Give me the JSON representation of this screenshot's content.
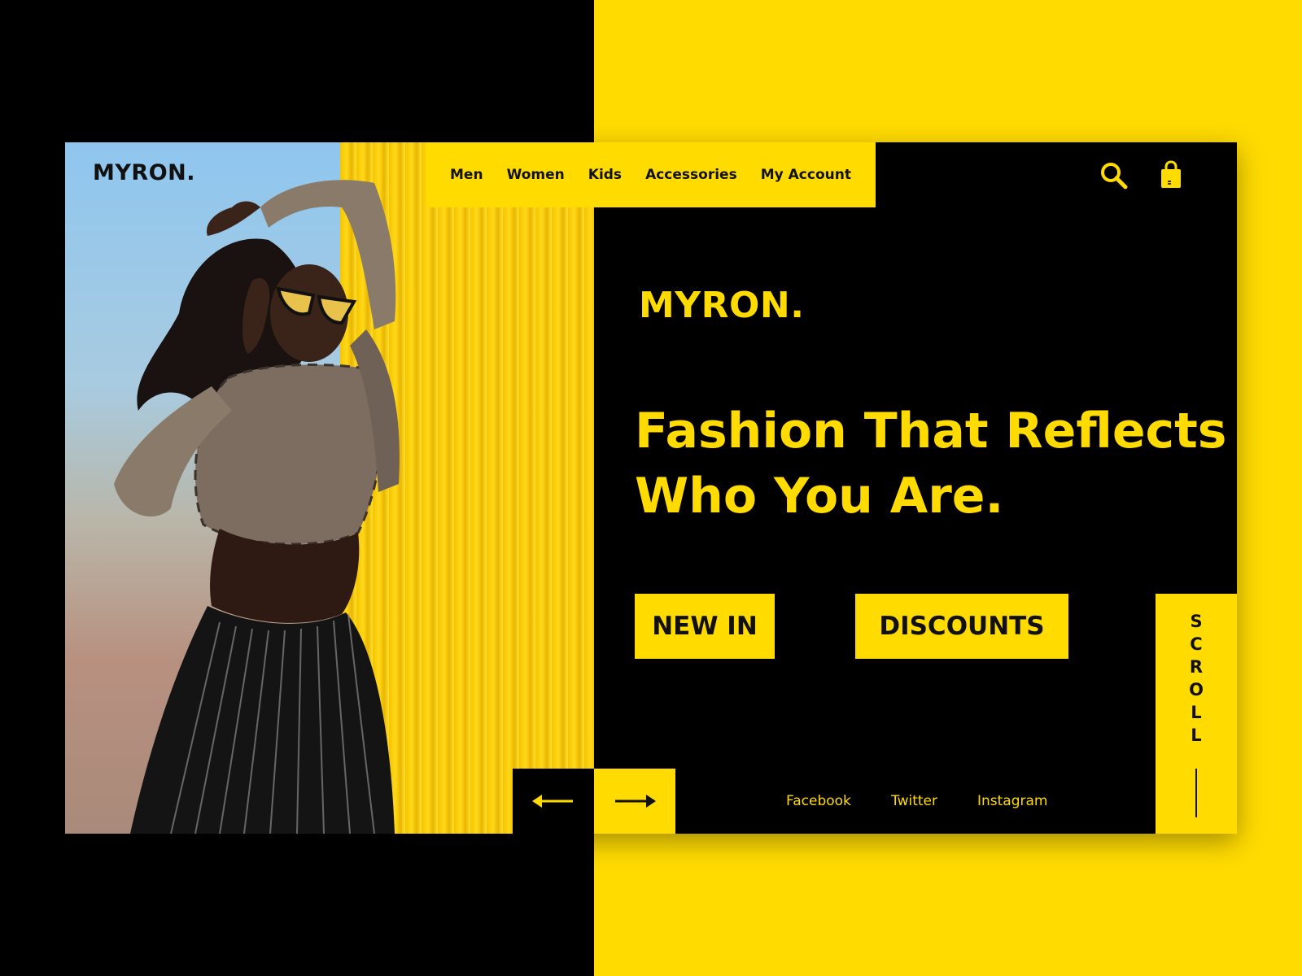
{
  "brand": {
    "logo_dark": "MYRON.",
    "logo_yellow": "MYRON.",
    "accent_color": "#FFDB00",
    "dark_color": "#000000"
  },
  "nav": {
    "items": [
      {
        "label": "Men"
      },
      {
        "label": "Women"
      },
      {
        "label": "Kids"
      },
      {
        "label": "Accessories"
      },
      {
        "label": "My Account"
      }
    ]
  },
  "header_icons": [
    "search-icon",
    "shopping-bag-icon"
  ],
  "hero": {
    "headline_line1": "Fashion That Reflects",
    "headline_line2": "Who You Are."
  },
  "buttons": {
    "new_in": "NEW IN",
    "discounts": "DISCOUNTS"
  },
  "scroll": {
    "letters": [
      "S",
      "C",
      "R",
      "O",
      "L",
      "L"
    ]
  },
  "carousel": {
    "prev_icon": "arrow-left-icon",
    "next_icon": "arrow-right-icon"
  },
  "social": {
    "facebook": "Facebook",
    "twitter": "Twitter",
    "instagram": "Instagram"
  }
}
